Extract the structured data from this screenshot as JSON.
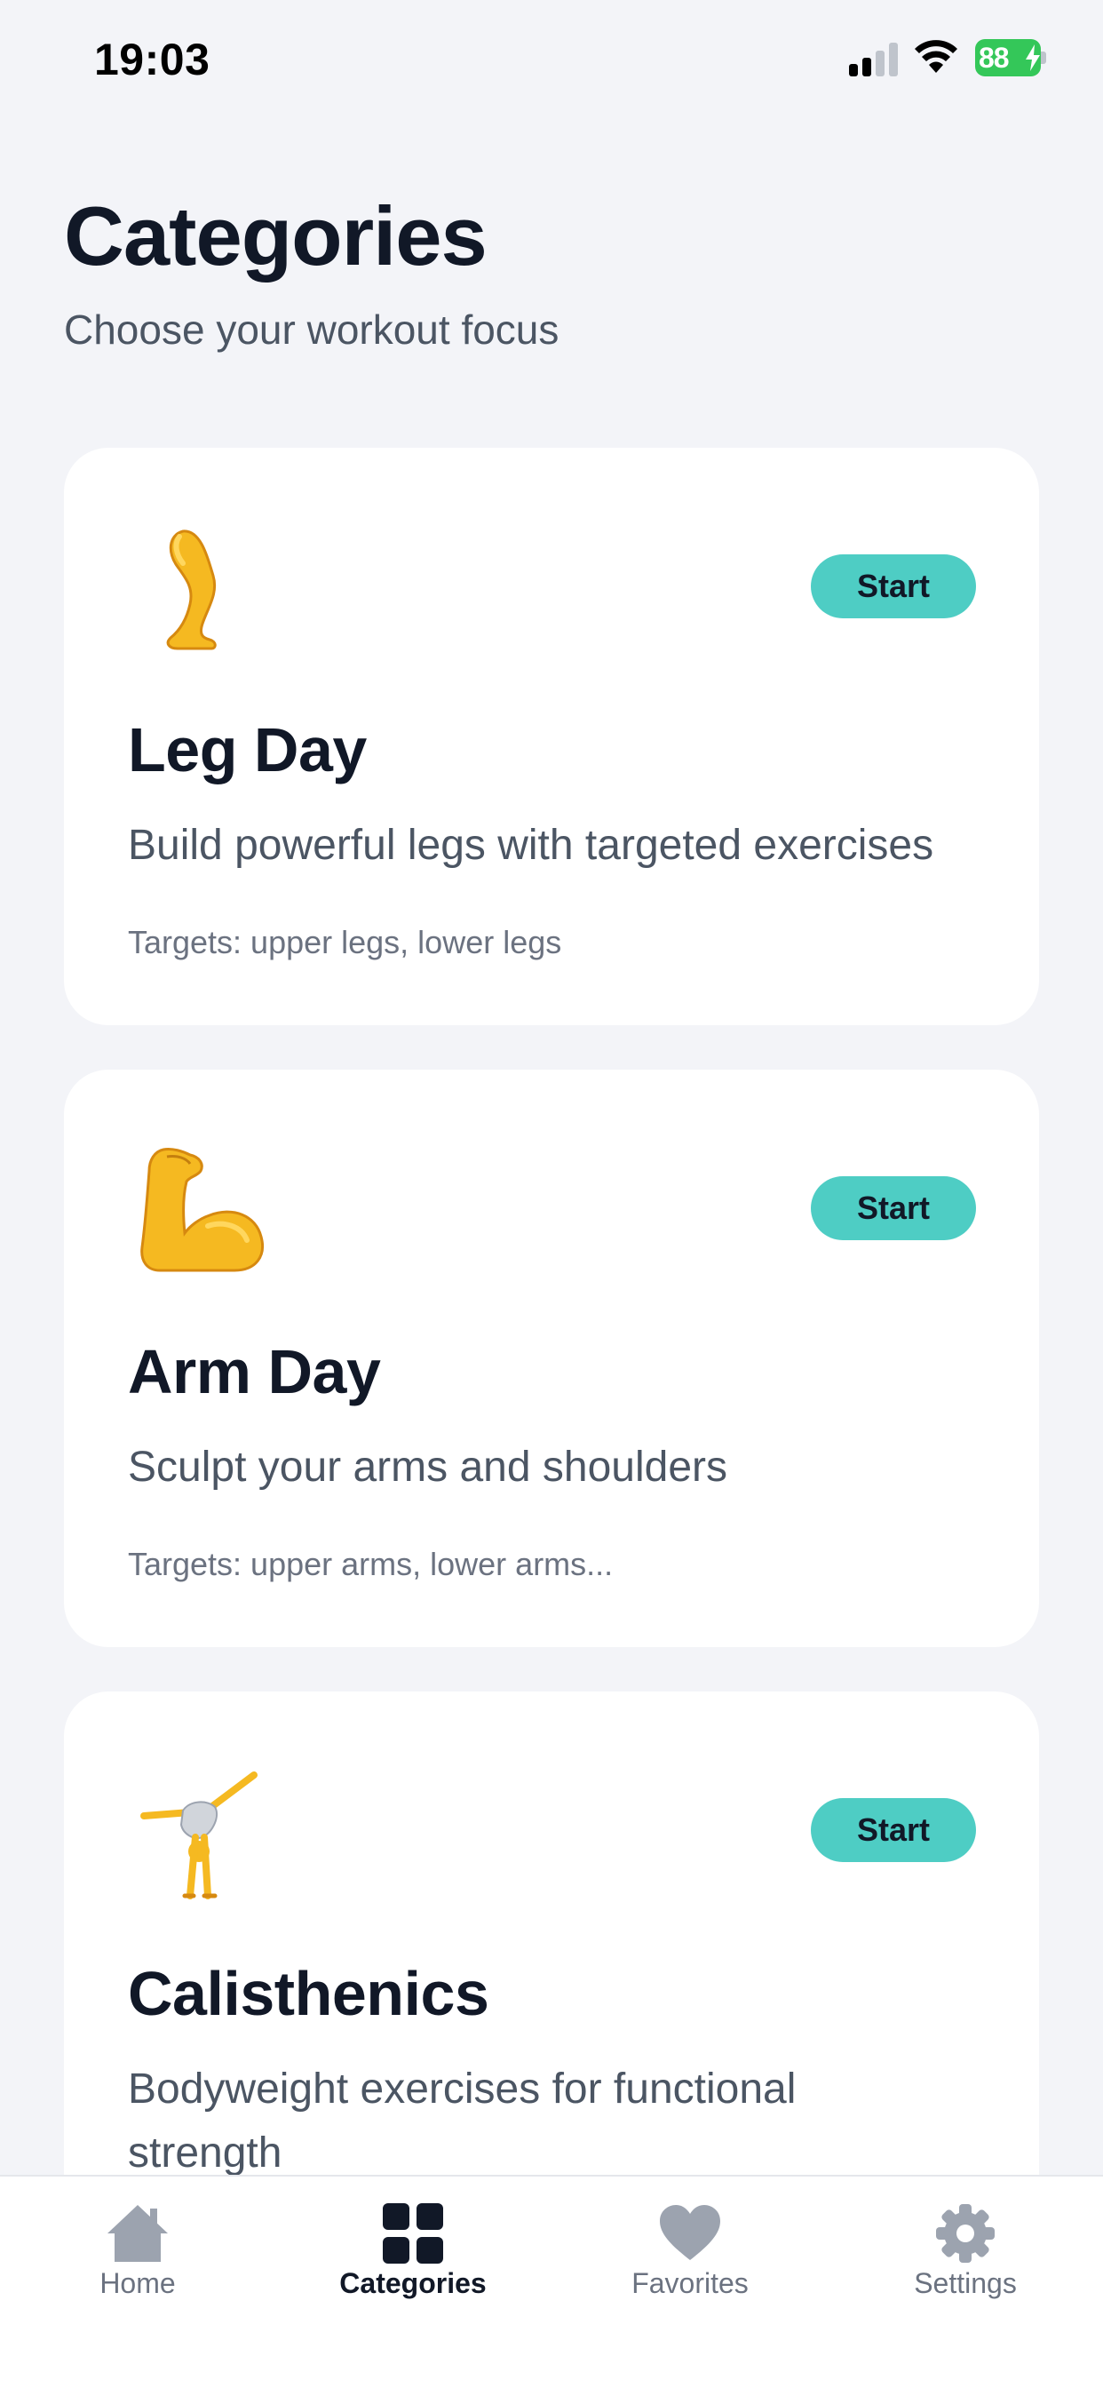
{
  "status_bar": {
    "time": "19:03",
    "battery": "88"
  },
  "header": {
    "title": "Categories",
    "subtitle": "Choose your workout focus"
  },
  "cards": [
    {
      "icon": "leg-emoji",
      "title": "Leg Day",
      "description": "Build powerful legs with targeted exercises",
      "targets": "Targets: upper legs, lower legs",
      "button": "Start"
    },
    {
      "icon": "flexed-biceps-emoji",
      "title": "Arm Day",
      "description": "Sculpt your arms and shoulders",
      "targets": "Targets: upper arms, lower arms...",
      "button": "Start"
    },
    {
      "icon": "cartwheel-emoji",
      "title": "Calisthenics",
      "description": "Bodyweight exercises for functional strength",
      "button": "Start"
    }
  ],
  "tab_bar": {
    "tabs": [
      {
        "label": "Home",
        "icon": "home-icon",
        "active": false
      },
      {
        "label": "Categories",
        "icon": "grid-icon",
        "active": true
      },
      {
        "label": "Favorites",
        "icon": "heart-icon",
        "active": false
      },
      {
        "label": "Settings",
        "icon": "gear-icon",
        "active": false
      }
    ]
  },
  "colors": {
    "background": "#F3F4F8",
    "accent": "#4ECDC4",
    "title": "#111827",
    "muted": "#6B7280",
    "battery": "#34C759"
  }
}
